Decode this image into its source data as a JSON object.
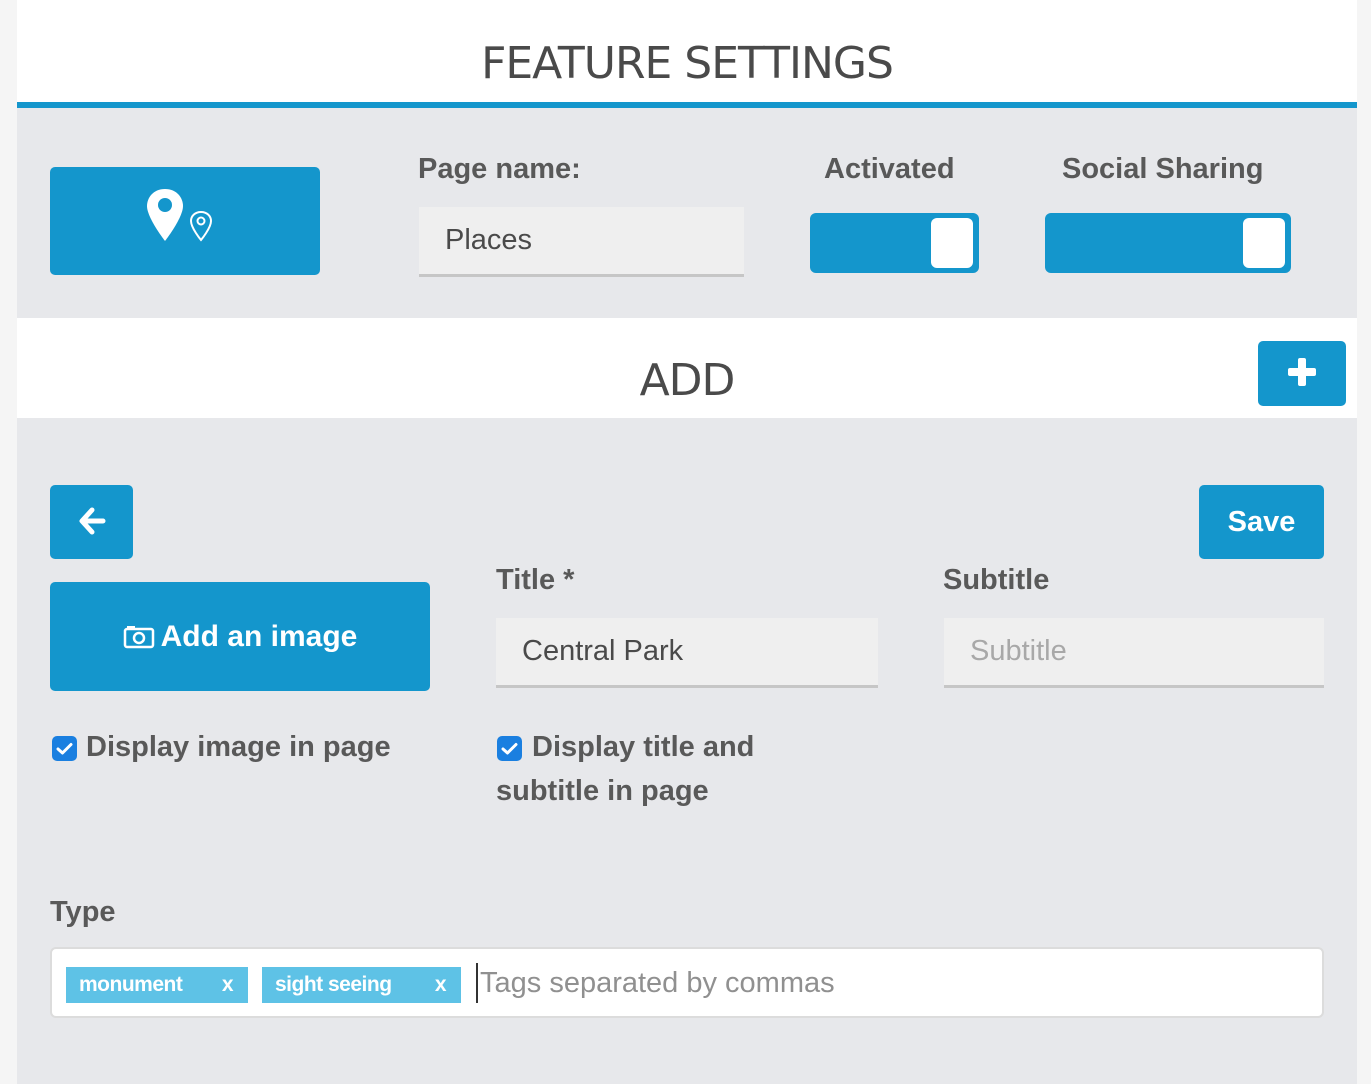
{
  "header": {
    "title": "FEATURE SETTINGS"
  },
  "feature": {
    "icon": "map-pin-icon",
    "page_name_label": "Page name:",
    "page_name_value": "Places",
    "activated_label": "Activated",
    "activated_on": true,
    "social_label": "Social Sharing",
    "social_on": true
  },
  "add_section": {
    "title": "ADD",
    "add_icon": "plus-icon"
  },
  "form": {
    "back_icon": "arrow-left-icon",
    "save_label": "Save",
    "add_image_label": "Add an image",
    "add_image_icon": "camera-icon",
    "title_label": "Title *",
    "title_value": "Central Park",
    "subtitle_label": "Subtitle",
    "subtitle_placeholder": "Subtitle",
    "display_image_label": "Display image in page",
    "display_image_checked": true,
    "display_title_label": "Display title and subtitle in page",
    "display_title_checked": true,
    "type_label": "Type",
    "tags": [
      "monument",
      "sight seeing"
    ],
    "tag_remove": "x",
    "tags_placeholder": "Tags separated by commas"
  },
  "colors": {
    "accent": "#1496cc",
    "tag": "#5ec2e6",
    "panel": "#e7e8eb"
  }
}
